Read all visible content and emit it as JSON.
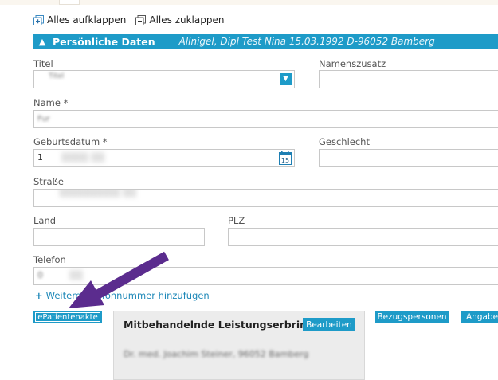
{
  "toolbar": {
    "expand_all": "Alles aufklappen",
    "collapse_all": "Alles zuklappen"
  },
  "section": {
    "title": "Persönliche Daten",
    "summary": "Allnigel, Dipl Test Nina 15.03.1992 D-96052 Bamberg"
  },
  "form": {
    "titel_label": "Titel",
    "titel_value": "Titel",
    "namenszusatz_label": "Namenszusatz",
    "namenszusatz_value": "",
    "name_label": "Name *",
    "name_value": "Fur",
    "geburtsdatum_label": "Geburtsdatum *",
    "geburtsdatum_value": "1",
    "geschlecht_label": "Geschlecht",
    "geschlecht_value": "",
    "strasse_label": "Straße",
    "strasse_value": "",
    "land_label": "Land",
    "land_value": "",
    "plz_label": "PLZ",
    "plz_value": "",
    "telefon_label": "Telefon",
    "telefon_value": "0",
    "add_phone": "Weitere Telefonnummer hinzufügen"
  },
  "buttons": {
    "epatientenakte": "ePatientenakte",
    "bearbeiten": "Bearbeiten",
    "bezugspersonen": "Bezugspersonen",
    "angaben": "Angaben"
  },
  "panel": {
    "title": "Mitbehandelnde Leistungserbringer",
    "doctor": "Dr. med. Joachim Steiner, 96052 Bamberg"
  },
  "colors": {
    "accent": "#1e9bc8",
    "annotation_arrow": "#5b2c8e"
  }
}
